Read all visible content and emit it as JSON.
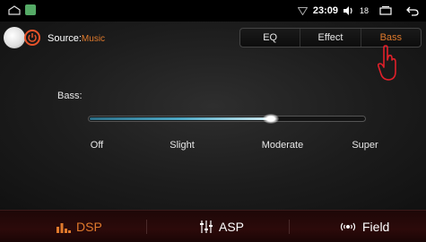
{
  "status_bar": {
    "time": "23:09",
    "volume": "18",
    "icons": [
      "home-icon",
      "gallery-icon",
      "wifi-icon",
      "volume-icon",
      "recent-apps-icon",
      "back-icon"
    ]
  },
  "source": {
    "label": "Source:",
    "value": "Music"
  },
  "tabs": [
    {
      "label": "EQ",
      "active": false
    },
    {
      "label": "Effect",
      "active": false
    },
    {
      "label": "Bass",
      "active": true
    }
  ],
  "bass": {
    "title": "Bass:",
    "levels": [
      "Off",
      "Slight",
      "Moderate",
      "Super"
    ],
    "value_fraction": 0.66
  },
  "bottom_nav": [
    {
      "label": "DSP",
      "icon": "equalizer-bars-icon",
      "active": true
    },
    {
      "label": "ASP",
      "icon": "sliders-icon",
      "active": false
    },
    {
      "label": "Field",
      "icon": "sound-field-icon",
      "active": false
    }
  ],
  "colors": {
    "accent": "#e07a2c",
    "power": "#e7532a",
    "slider_fill": "#4fa9c6"
  }
}
